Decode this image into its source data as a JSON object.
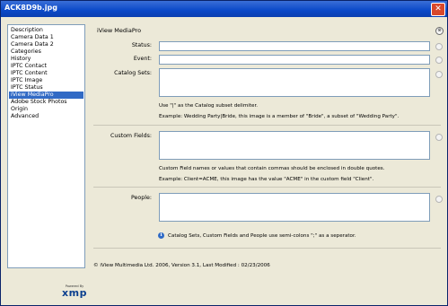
{
  "window": {
    "title": "ACK8D9b.jpg",
    "close_glyph": "✕"
  },
  "sidebar": {
    "items": [
      {
        "label": "Description",
        "selected": false
      },
      {
        "label": "Camera Data 1",
        "selected": false
      },
      {
        "label": "Camera Data 2",
        "selected": false
      },
      {
        "label": "Categories",
        "selected": false
      },
      {
        "label": "History",
        "selected": false
      },
      {
        "label": "IPTC Contact",
        "selected": false
      },
      {
        "label": "IPTC Content",
        "selected": false
      },
      {
        "label": "IPTC Image",
        "selected": false
      },
      {
        "label": "IPTC Status",
        "selected": false
      },
      {
        "label": "iView MediaPro",
        "selected": true
      },
      {
        "label": "Adobe Stock Photos",
        "selected": false
      },
      {
        "label": "Origin",
        "selected": false
      },
      {
        "label": "Advanced",
        "selected": false
      }
    ]
  },
  "logo": {
    "powered_by": "Powered By",
    "brand": "xmp"
  },
  "panel": {
    "title": "iView MediaPro",
    "fields": {
      "status": {
        "label": "Status:",
        "value": ""
      },
      "event": {
        "label": "Event:",
        "value": ""
      },
      "catalog_sets": {
        "label": "Catalog Sets:",
        "value": "",
        "hint1": "Use \"|\" as the Catalog subset delimiter.",
        "hint2": "Example: Wedding Party|Bride, this image is a member of \"Bride\", a subset of \"Wedding Party\"."
      },
      "custom_fields": {
        "label": "Custom Fields:",
        "value": "",
        "hint1": "Custom Field names or values that contain commas should be enclosed in double quotes.",
        "hint2": "Example: Client=ACME, this image has the value \"ACME\" in the custom field \"Client\"."
      },
      "people": {
        "label": "People:",
        "value": ""
      }
    },
    "info": "Catalog Sets, Custom Fields and People use semi-colons \";\" as a seperator.",
    "footer": "© iView Multimedia Ltd. 2006,  Version 3.1,  Last Modified : 02/23/2006"
  }
}
